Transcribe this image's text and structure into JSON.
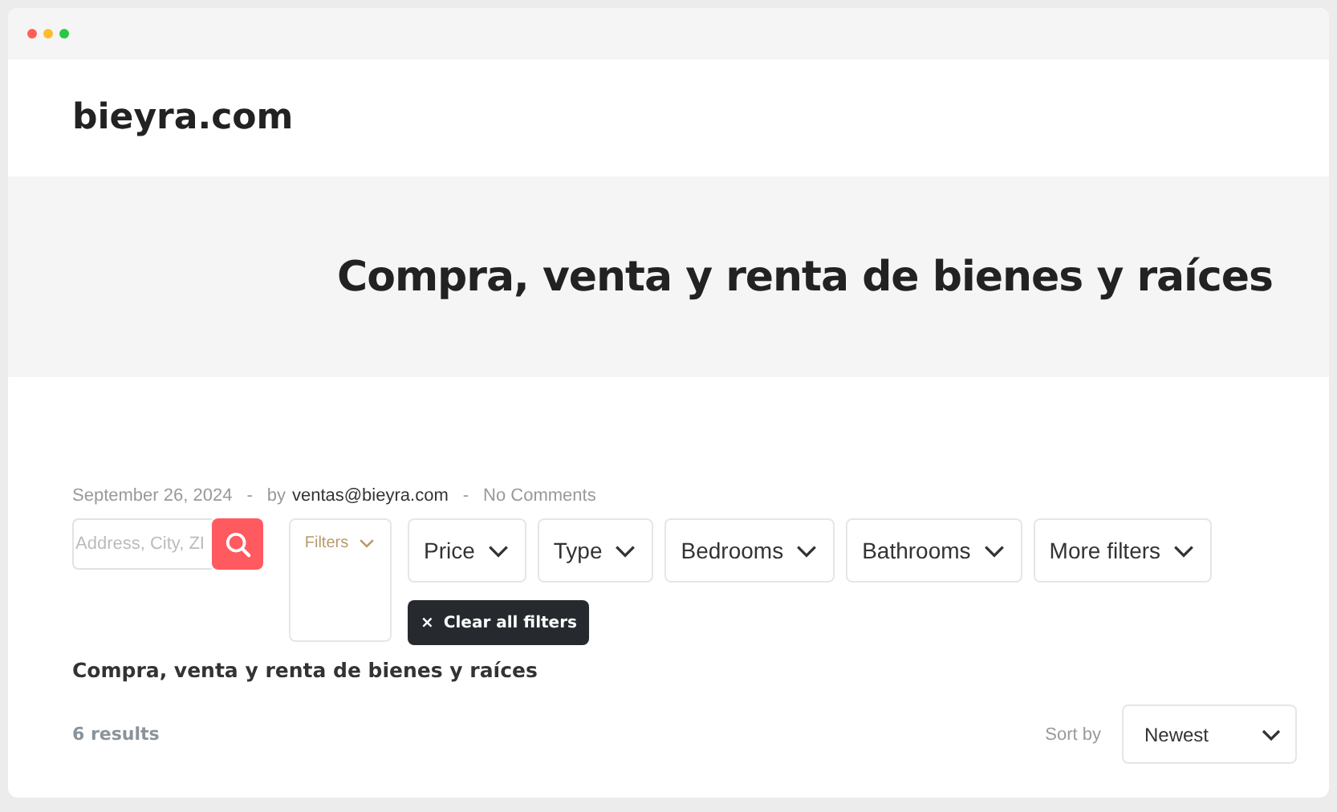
{
  "site": {
    "logo": "bieyra.com"
  },
  "hero": {
    "title": "Compra, venta y renta de bienes y raíces"
  },
  "meta": {
    "date": "September 26, 2024",
    "separator_1": "-",
    "by": "by",
    "author": "ventas@bieyra.com",
    "separator_2": "-",
    "comments": "No Comments"
  },
  "search": {
    "placeholder": "Address, City, ZI"
  },
  "filters_toggle": {
    "label": "Filters"
  },
  "filters": [
    {
      "label": "Price"
    },
    {
      "label": "Type"
    },
    {
      "label": "Bedrooms"
    },
    {
      "label": "Bathrooms"
    },
    {
      "label": "More filters"
    }
  ],
  "clear_filters": {
    "icon": "×",
    "label": "Clear all filters"
  },
  "listing": {
    "heading": "Compra, venta y renta de bienes y raíces",
    "count": "6 results",
    "sort_label": "Sort by",
    "sort_value": "Newest"
  }
}
